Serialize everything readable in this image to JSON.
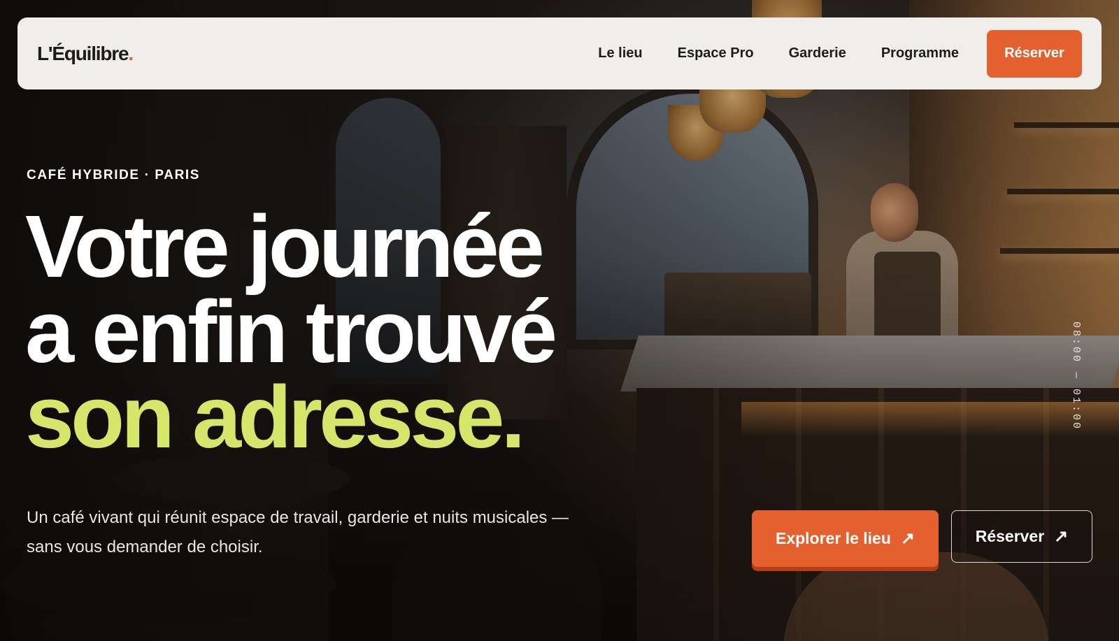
{
  "nav": {
    "logo": "L'Équilibre",
    "logo_dot": ".",
    "links": [
      "Le lieu",
      "Espace Pro",
      "Garderie",
      "Programme"
    ],
    "cta_label": "Réserver"
  },
  "hero": {
    "eyebrow": "CAFÉ HYBRIDE · PARIS",
    "headline_line1": "Votre journée",
    "headline_line2": "a enfin trouvé",
    "headline_accent": "son adresse.",
    "subcopy": "Un café vivant qui réunit espace de travail, garderie et nuits musicales — sans vous demander de choisir.",
    "hours": "08:00 — 01:00",
    "primary_cta": "Explorer le lieu",
    "secondary_cta": "Réserver",
    "arrow_icon": "arrow-up-right-icon"
  },
  "colors": {
    "accent_orange": "#e4602e",
    "accent_lime": "#d6e66a",
    "nav_bg": "#efeeea"
  }
}
